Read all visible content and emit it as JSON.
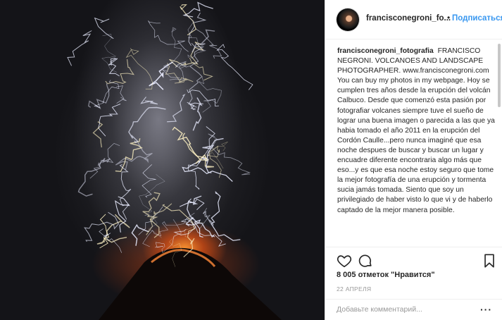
{
  "post": {
    "photo_alt": "Volcanic eruption with lightning storm",
    "icons": [
      "heart-icon",
      "comment-icon",
      "bookmark-icon",
      "more-options-icon"
    ]
  },
  "header": {
    "username": "francisconegroni_fo...",
    "separator": "•",
    "follow_label": "Подписаться"
  },
  "caption": {
    "username": "francisconegroni_fotografia",
    "text": "FRANCISCO NEGRONI. VOLCANOES AND LANDSCAPE PHOTOGRAPHER. www.francisconegroni.com You can buy my photos in my webpage. Hoy se cumplen tres años desde la erupción del volcán Calbuco. Desde que comenzó esta pasión por fotografiar volcanes siempre tuve el sueño de lograr una buena imagen o parecida a las que ya habia tomado el año 2011 en la erupción del Cordón Caulle...pero nunca imaginé que esa noche despues de buscar y buscar un lugar y encuadre diferente encontraria algo más que eso...y es que esa noche estoy seguro que tome la mejor fotografía de una erupción y tormenta sucia jamás tomada. Siento que soy un privilegiado de haber visto lo que vi y de haberlo captado de la mejor manera posible."
  },
  "footer": {
    "likes": "8 005 отметок \"Нравится\"",
    "date": "22 АПРЕЛЯ",
    "comment_placeholder": "Добавьте комментарий...",
    "more_label": "···"
  }
}
